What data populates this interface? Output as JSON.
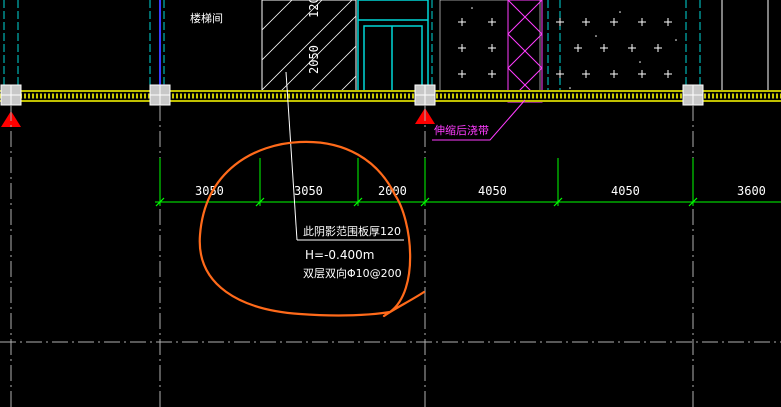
{
  "drawing": {
    "room_label": "楼梯间",
    "wall_dim_top": "120",
    "wall_dim_height": "2050",
    "expansion_band_label": "伸缩后浇带",
    "dimensions": [
      "3050",
      "3050",
      "2000",
      "4050",
      "4050",
      "3600"
    ],
    "annotation": {
      "line1": "此阴影范围板厚120",
      "line2": "H=-0.400m",
      "line3": "双层双向Φ10@200"
    },
    "colors": {
      "background": "#000000",
      "grid": "#ffffff",
      "dimension_line": "#00ff00",
      "beam_band": "#ffff00",
      "markup": "#ff6a1a",
      "expansion_band": "#ff3cff",
      "column_marker": "#ff0000"
    }
  }
}
